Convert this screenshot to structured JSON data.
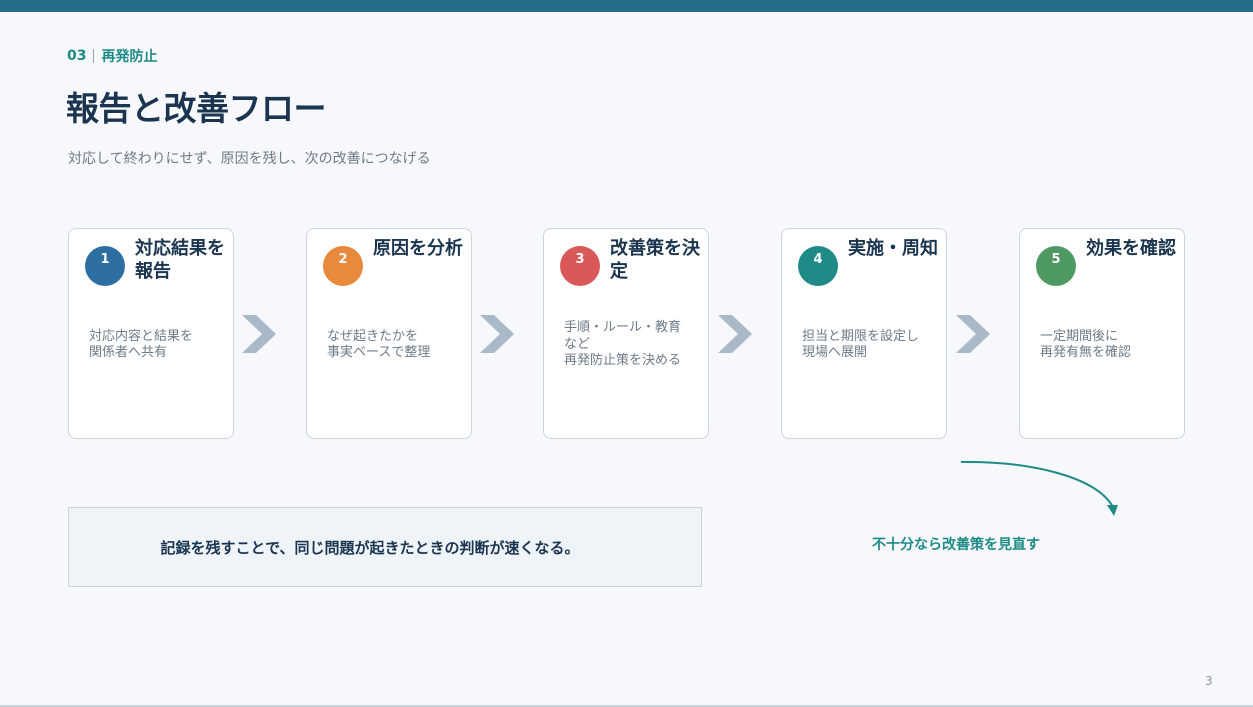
{
  "section": {
    "number": "03",
    "label": "再発防止"
  },
  "title": "報告と改善フロー",
  "subtitle": "対応して終わりにせず、原因を残し、次の改善につなげる",
  "steps": [
    {
      "num": "1",
      "title": "対応結果を報告",
      "desc": "対応内容と結果を\n関係者へ共有",
      "color": "#2e6fa3"
    },
    {
      "num": "2",
      "title": "原因を分析",
      "desc": "なぜ起きたかを\n事実ベースで整理",
      "color": "#e8893c"
    },
    {
      "num": "3",
      "title": "改善策を決定",
      "desc": "手順・ルール・教育\nなど\n再発防止策を決める",
      "color": "#d95858"
    },
    {
      "num": "4",
      "title": "実施・周知",
      "desc": "担当と期限を設定し\n現場へ展開",
      "color": "#1f8a86"
    },
    {
      "num": "5",
      "title": "効果を確認",
      "desc": "一定期間後に\n再発有無を確認",
      "color": "#4f9a63"
    }
  ],
  "note": "記録を残すことで、同じ問題が起きたときの判断が速くなる。",
  "loop_label": "不十分なら改善策を見直す",
  "page_number": "3",
  "colors": {
    "accent": "#236d86",
    "teal": "#1f8a86",
    "chevron": "#a9b9c7"
  }
}
